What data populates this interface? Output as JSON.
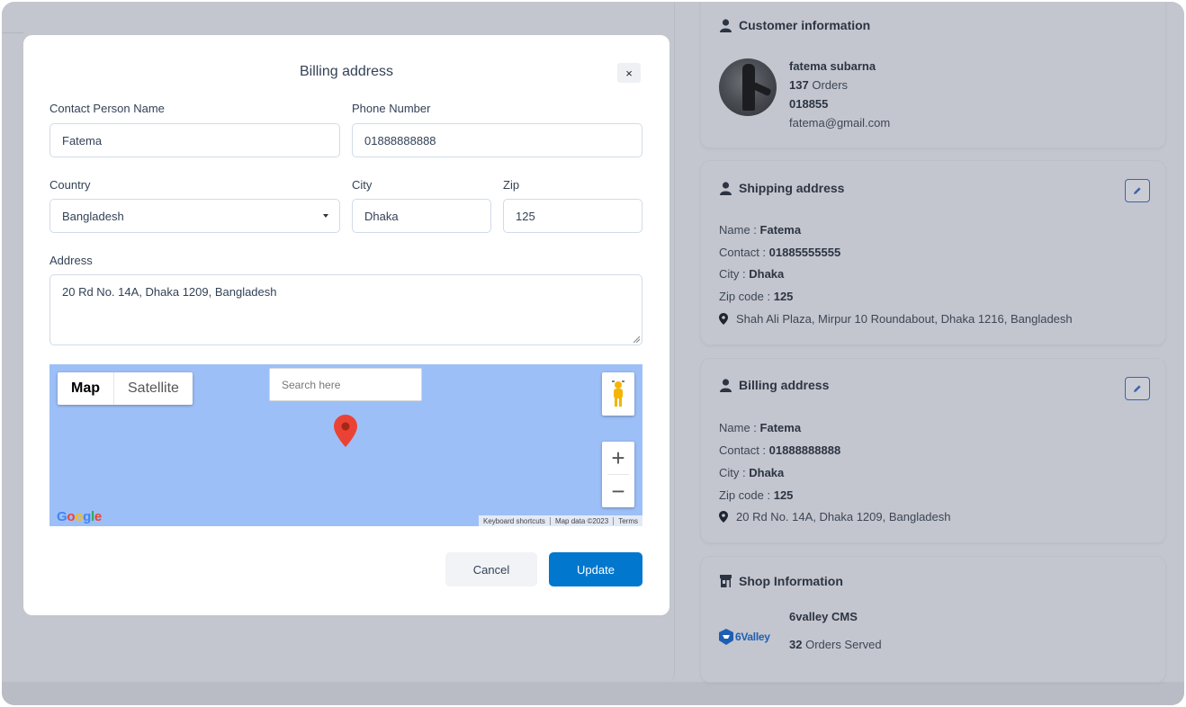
{
  "customer": {
    "title": "Customer information",
    "name": "fatema subarna",
    "orders_count": "137",
    "orders_label": "Orders",
    "phone": "018855",
    "email": "fatema@gmail.com"
  },
  "shipping": {
    "title": "Shipping address",
    "name_label": "Name :",
    "name": "Fatema",
    "contact_label": "Contact :",
    "contact": "01885555555",
    "city_label": "City :",
    "city": "Dhaka",
    "zip_label": "Zip code :",
    "zip": "125",
    "address": "Shah Ali Plaza, Mirpur 10 Roundabout, Dhaka 1216, Bangladesh"
  },
  "billing": {
    "title": "Billing address",
    "name_label": "Name :",
    "name": "Fatema",
    "contact_label": "Contact :",
    "contact": "01888888888",
    "city_label": "City :",
    "city": "Dhaka",
    "zip_label": "Zip code :",
    "zip": "125",
    "address": "20 Rd No. 14A, Dhaka 1209, Bangladesh"
  },
  "shop": {
    "title": "Shop Information",
    "logo_text": "6Valley",
    "name": "6valley CMS",
    "orders_count": "32",
    "orders_label": "Orders Served"
  },
  "modal": {
    "title": "Billing address",
    "close": "×",
    "contact_name_label": "Contact Person Name",
    "contact_name_value": "Fatema",
    "phone_label": "Phone Number",
    "phone_value": "01888888888",
    "country_label": "Country",
    "country_value": "Bangladesh",
    "city_label": "City",
    "city_value": "Dhaka",
    "zip_label": "Zip",
    "zip_value": "125",
    "address_label": "Address",
    "address_value": "20 Rd No. 14A, Dhaka 1209, Bangladesh",
    "cancel": "Cancel",
    "update": "Update"
  },
  "map": {
    "tab_map": "Map",
    "tab_satellite": "Satellite",
    "search_placeholder": "Search here",
    "zoom_in": "+",
    "zoom_out": "−",
    "attribution": [
      "Keyboard shortcuts",
      "Map data ©2023",
      "Terms"
    ]
  },
  "colors": {
    "primary": "#0177cd",
    "overlay": "#c3c6ce",
    "map_water": "#9dbff7",
    "pin": "#ea4335"
  }
}
